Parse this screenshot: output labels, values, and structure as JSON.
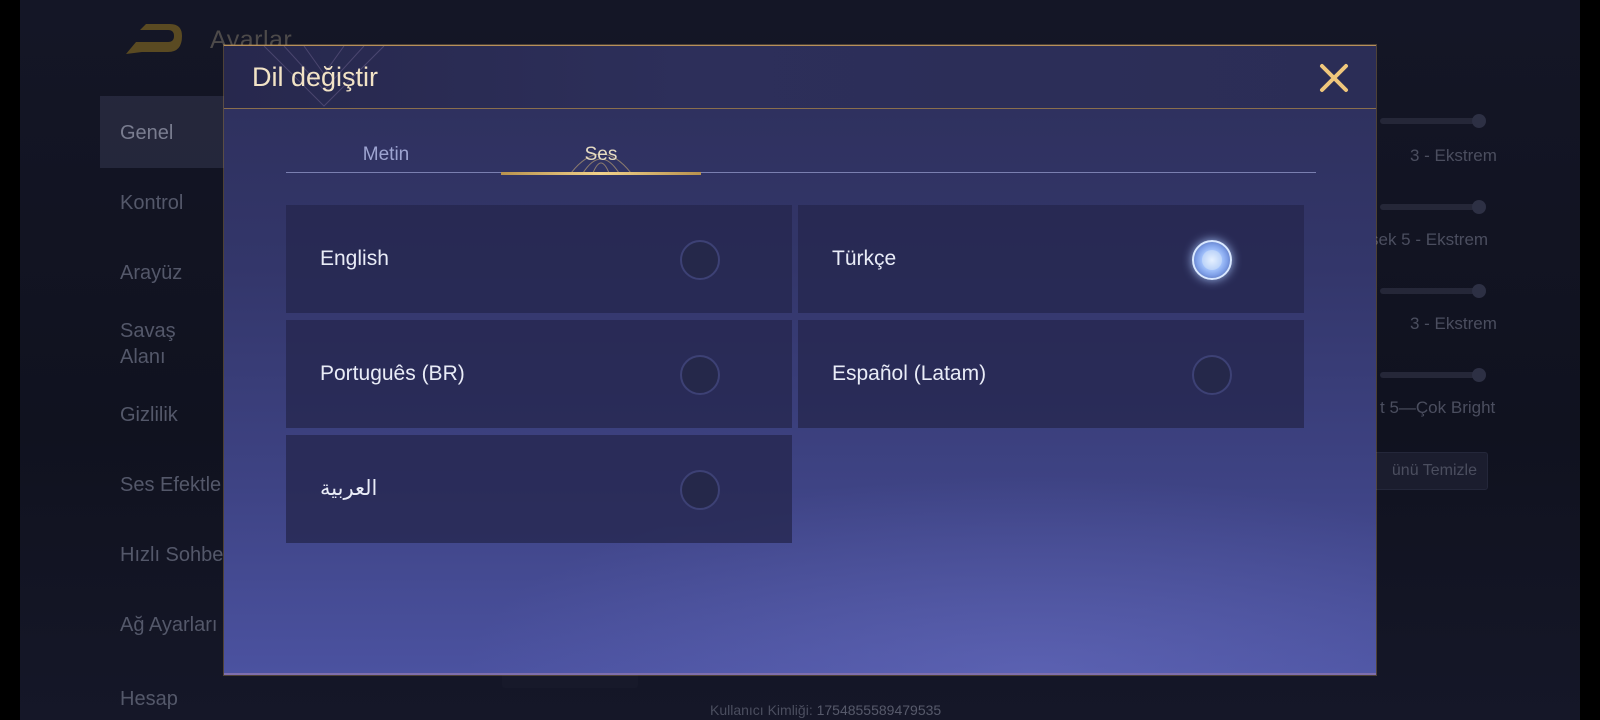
{
  "background": {
    "title": "Ayarlar",
    "sidebar": {
      "items": [
        {
          "label": "Genel"
        },
        {
          "label": "Kontrol"
        },
        {
          "label": "Arayüz"
        },
        {
          "label": "Savaş\nAlanı"
        },
        {
          "label": "Gizlilik"
        },
        {
          "label": "Ses Efektle"
        },
        {
          "label": "Hızlı Sohbe"
        },
        {
          "label": "Ağ Ayarları"
        },
        {
          "label": "Hesap"
        }
      ]
    },
    "right_settings": [
      {
        "label": "3 - Ekstrem"
      },
      {
        "label": "sek  5 - Ekstrem"
      },
      {
        "label": "3 - Ekstrem"
      },
      {
        "label": "t   5—Çok Bright"
      }
    ],
    "clear_button": "ünü Temizle",
    "user_id_label": "Kullanıcı Kimliği:",
    "user_id_value": "1754855589479535"
  },
  "dialog": {
    "title": "Dil değiştir",
    "tabs": [
      {
        "label": "Metin",
        "active": false
      },
      {
        "label": "Ses",
        "active": true
      }
    ],
    "languages": [
      {
        "label": "English",
        "selected": false
      },
      {
        "label": "Türkçe",
        "selected": true
      },
      {
        "label": "Português (BR)",
        "selected": false
      },
      {
        "label": "Español (Latam)",
        "selected": false
      },
      {
        "label": "العربية",
        "selected": false
      }
    ]
  },
  "colors": {
    "accent_gold": "#f2d28b",
    "dialog_bg": "#33366a",
    "option_bg": "#25274e",
    "selected_radio": "#a9c8ff"
  }
}
